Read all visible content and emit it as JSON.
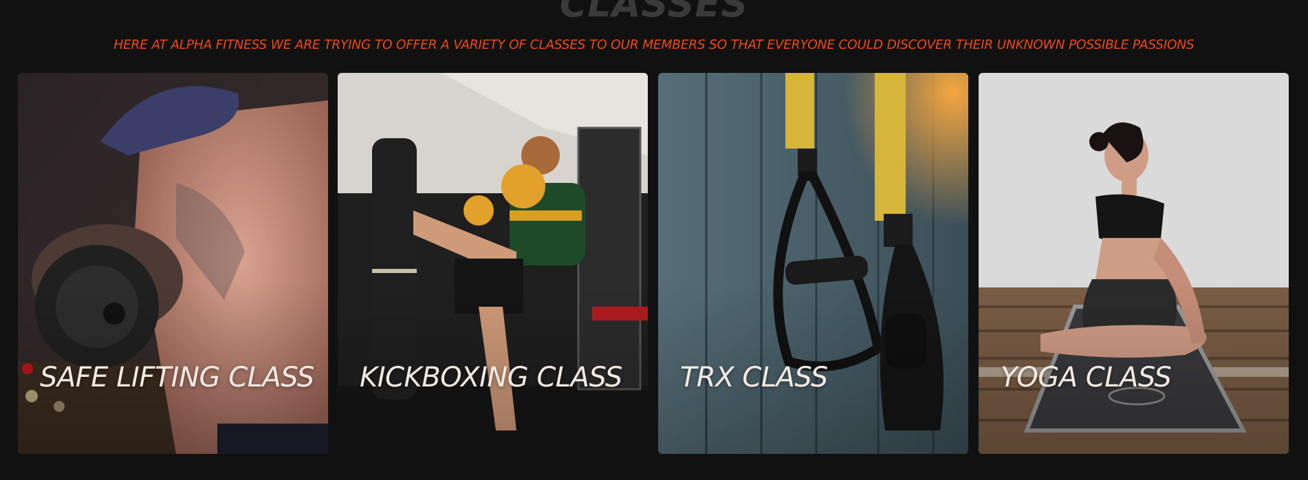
{
  "section": {
    "title": "CLASSES",
    "subtitle": "HERE AT ALPHA FITNESS WE ARE TRYING TO OFFER A VARIETY OF CLASSES TO OUR MEMBERS SO THAT EVERYONE COULD DISCOVER THEIR UNKNOWN POSSIBLE PASSIONS"
  },
  "classes": [
    {
      "label": "SAFE LIFTING CLASS",
      "image_icon": "weightlifting-photo"
    },
    {
      "label": "KICKBOXING CLASS",
      "image_icon": "kickboxing-photo"
    },
    {
      "label": "TRX CLASS",
      "image_icon": "trx-straps-photo"
    },
    {
      "label": "YOGA CLASS",
      "image_icon": "yoga-photo"
    }
  ],
  "colors": {
    "background": "#111111",
    "subtitle": "#ee4a12",
    "title": "#3a3a3a",
    "label": "#f3ebe3"
  }
}
